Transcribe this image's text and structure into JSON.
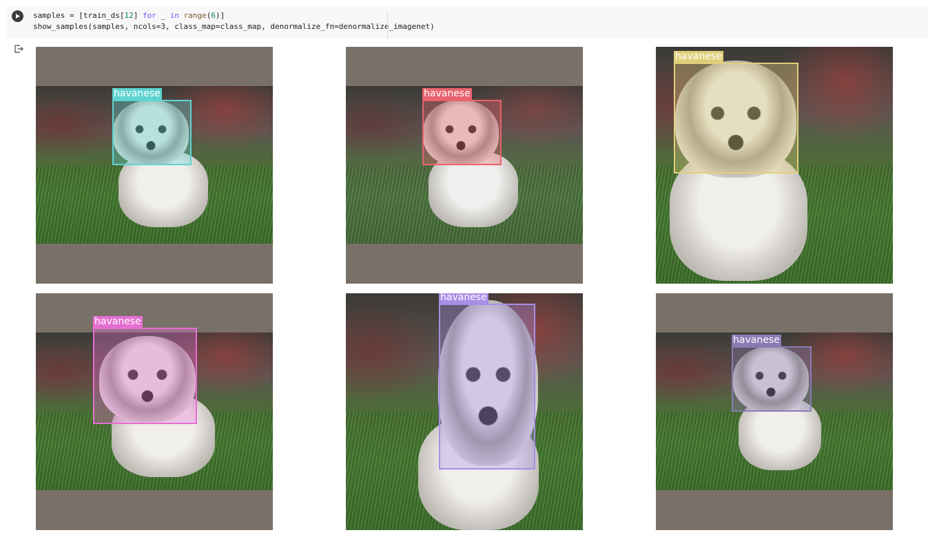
{
  "cell": {
    "code_line1_a": "samples = [train_ds[",
    "code_line1_num": "12",
    "code_line1_b": "] ",
    "code_line1_for": "for",
    "code_line1_c": " _ ",
    "code_line1_in": "in",
    "code_line1_d": " ",
    "code_line1_range": "range",
    "code_line1_e": "(",
    "code_line1_six": "6",
    "code_line1_f": ")]",
    "code_line2": "show_samples(samples, ncols=3, class_map=class_map, denormalize_fn=denormalize_imagenet)",
    "run_icon": "play-icon",
    "output_icon": "output-arrow-icon"
  },
  "samples": [
    {
      "label": "havanese",
      "color": "#5ed4d2"
    },
    {
      "label": "havanese",
      "color": "#e8636e"
    },
    {
      "label": "havanese",
      "color": "#e0cf7a"
    },
    {
      "label": "havanese",
      "color": "#e46fd0"
    },
    {
      "label": "havanese",
      "color": "#a98ee8"
    },
    {
      "label": "havanese",
      "color": "#8a7cb2"
    }
  ]
}
